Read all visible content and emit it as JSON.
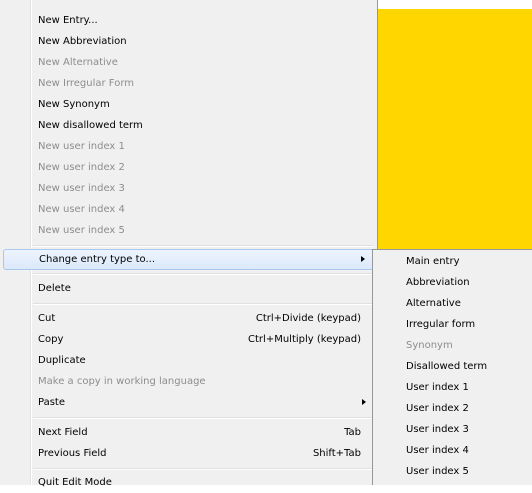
{
  "colors": {
    "accent_background": "#ffd600",
    "menu_background": "#f0f0f0",
    "disabled_text": "#8d8d8d"
  },
  "menu": {
    "items": [
      {
        "label": "New Entry...",
        "disabled": false
      },
      {
        "label": "New Abbreviation",
        "disabled": false
      },
      {
        "label": "New Alternative",
        "disabled": true
      },
      {
        "label": "New Irregular Form",
        "disabled": true
      },
      {
        "label": "New Synonym",
        "disabled": false
      },
      {
        "label": "New disallowed term",
        "disabled": false
      },
      {
        "label": "New user index 1",
        "disabled": true
      },
      {
        "label": "New user index 2",
        "disabled": true
      },
      {
        "label": "New user index 3",
        "disabled": true
      },
      {
        "label": "New user index 4",
        "disabled": true
      },
      {
        "label": "New user index 5",
        "disabled": true
      },
      {
        "label": "Change entry type to...",
        "disabled": false,
        "submenu": true,
        "highlighted": true
      },
      {
        "label": "Delete",
        "disabled": false
      },
      {
        "label": "Cut",
        "shortcut": "Ctrl+Divide (keypad)",
        "disabled": false
      },
      {
        "label": "Copy",
        "shortcut": "Ctrl+Multiply (keypad)",
        "disabled": false
      },
      {
        "label": "Duplicate",
        "disabled": false
      },
      {
        "label": "Make a copy in working language",
        "disabled": true
      },
      {
        "label": "Paste",
        "disabled": false,
        "submenu": true
      },
      {
        "label": "Next Field",
        "shortcut": "Tab",
        "disabled": false
      },
      {
        "label": "Previous Field",
        "shortcut": "Shift+Tab",
        "disabled": false
      },
      {
        "label": "Quit Edit Mode",
        "disabled": false
      }
    ]
  },
  "submenu": {
    "items": [
      {
        "label": "Main entry",
        "disabled": false
      },
      {
        "label": "Abbreviation",
        "disabled": false
      },
      {
        "label": "Alternative",
        "disabled": false
      },
      {
        "label": "Irregular form",
        "disabled": false
      },
      {
        "label": "Synonym",
        "disabled": true
      },
      {
        "label": "Disallowed term",
        "disabled": false
      },
      {
        "label": "User index 1",
        "disabled": false
      },
      {
        "label": "User index 2",
        "disabled": false
      },
      {
        "label": "User index 3",
        "disabled": false
      },
      {
        "label": "User index 4",
        "disabled": false
      },
      {
        "label": "User index 5",
        "disabled": false
      }
    ]
  }
}
